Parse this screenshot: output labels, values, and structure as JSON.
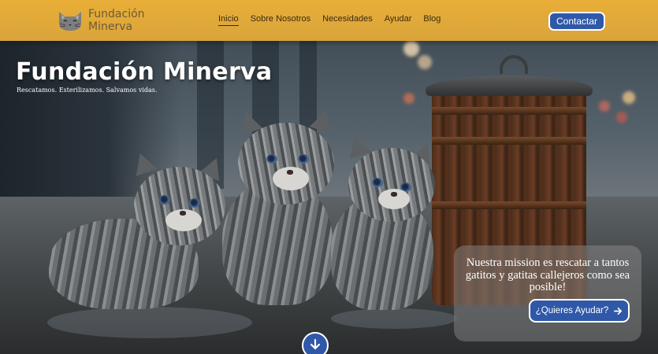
{
  "header": {
    "brand_line1": "Fundación",
    "brand_line2": "Minerva",
    "logo_icon": "cat-face-icon",
    "nav": [
      {
        "label": "Inicio",
        "active": true
      },
      {
        "label": "Sobre Nosotros",
        "active": false
      },
      {
        "label": "Necesidades",
        "active": false
      },
      {
        "label": "Ayudar",
        "active": false
      },
      {
        "label": "Blog",
        "active": false
      }
    ],
    "contact_label": "Contactar"
  },
  "hero": {
    "title": "Fundación Minerva",
    "subtitle": "Rescatamos. Esterilizamos. Salvamos vidas.",
    "image_icon": "kittens-photo"
  },
  "mission": {
    "text": "Nuestra mission es rescatar a tantos gatitos y gatitas callejeros como sea posible!",
    "button_label": "¿Quieres Ayudar?",
    "button_icon": "arrow-right-icon"
  },
  "scroll_down_icon": "arrow-down-icon",
  "colors": {
    "header_bg": "#e0a93a",
    "accent_blue": "#2f58a9",
    "brand_text": "#6e5a36",
    "nav_text": "#3a2a12"
  }
}
